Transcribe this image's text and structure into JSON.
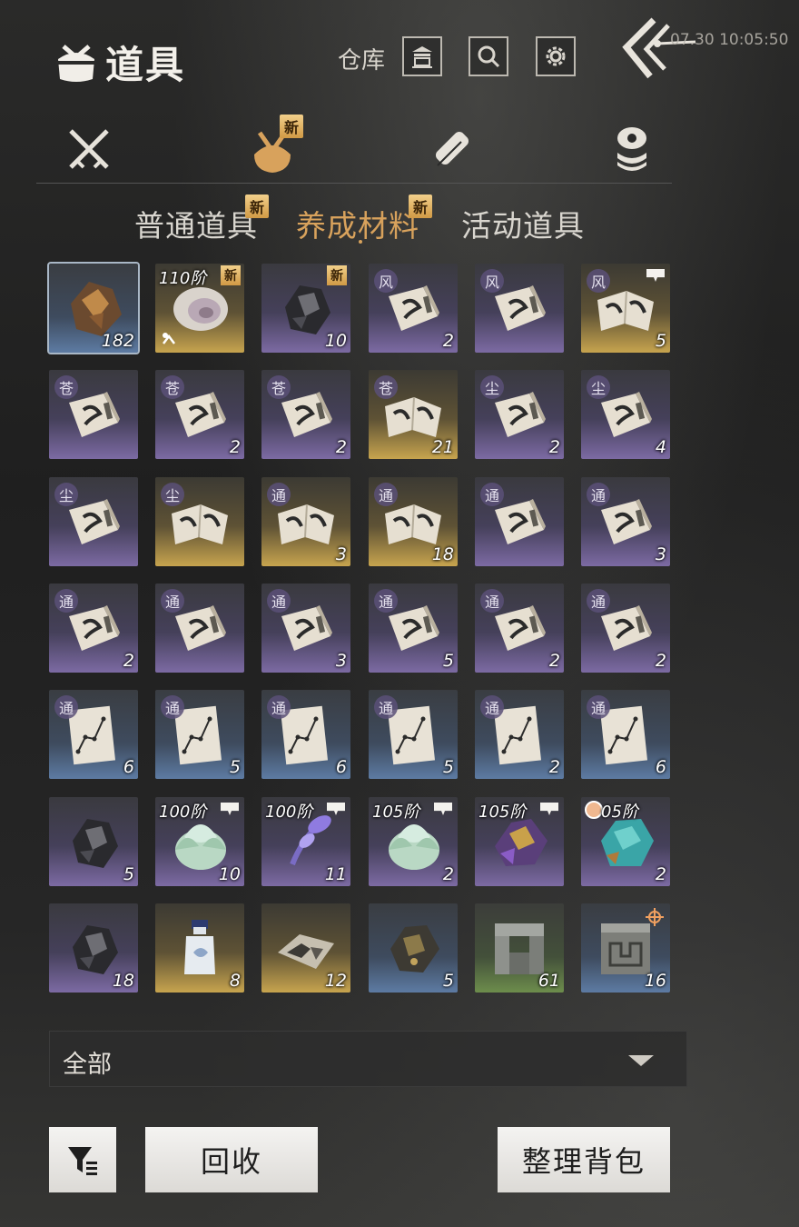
{
  "header": {
    "title": "道具",
    "warehouse_label": "仓库",
    "clock": "07.30 10:05:50"
  },
  "categories": [
    {
      "name": "weapons",
      "icon": "crossed-swords-icon",
      "new": false
    },
    {
      "name": "items",
      "icon": "bundle-sack-icon",
      "new": true,
      "active": true
    },
    {
      "name": "scrolls",
      "icon": "scroll-icon",
      "new": false
    },
    {
      "name": "materials",
      "icon": "gem-stack-icon",
      "new": false
    }
  ],
  "new_badge": "新",
  "subtabs": [
    {
      "label": "普通道具",
      "new": true,
      "active": false
    },
    {
      "label": "养成材料",
      "new": true,
      "active": true
    },
    {
      "label": "活动道具",
      "new": false,
      "active": false
    }
  ],
  "items": [
    {
      "art": "ore-brown",
      "bg": "blue",
      "count": "182",
      "selected": true
    },
    {
      "art": "shell",
      "bg": "gold",
      "tier": "110阶",
      "new": true,
      "up": true
    },
    {
      "art": "ore-dark",
      "bg": "purple",
      "count": "10",
      "new": true
    },
    {
      "art": "book",
      "bg": "purple",
      "glyph": "风",
      "count": "2"
    },
    {
      "art": "book",
      "bg": "purple",
      "glyph": "风",
      "count": ""
    },
    {
      "art": "book-open",
      "bg": "gold",
      "glyph": "风",
      "count": "5",
      "flag": true
    },
    {
      "art": "book",
      "bg": "purple",
      "glyph": "苍",
      "count": ""
    },
    {
      "art": "book",
      "bg": "purple",
      "glyph": "苍",
      "count": "2"
    },
    {
      "art": "book",
      "bg": "purple",
      "glyph": "苍",
      "count": "2"
    },
    {
      "art": "book-open",
      "bg": "gold",
      "glyph": "苍",
      "count": "21"
    },
    {
      "art": "book",
      "bg": "purple",
      "glyph": "尘",
      "count": "2"
    },
    {
      "art": "book",
      "bg": "purple",
      "glyph": "尘",
      "count": "4"
    },
    {
      "art": "book",
      "bg": "purple",
      "glyph": "尘",
      "count": ""
    },
    {
      "art": "book-open",
      "bg": "gold",
      "glyph": "尘",
      "count": ""
    },
    {
      "art": "book-open",
      "bg": "gold",
      "glyph": "通",
      "count": "3"
    },
    {
      "art": "book-open",
      "bg": "gold",
      "glyph": "通",
      "count": "18"
    },
    {
      "art": "book",
      "bg": "purple",
      "glyph": "通",
      "count": ""
    },
    {
      "art": "book",
      "bg": "purple",
      "glyph": "通",
      "count": "3"
    },
    {
      "art": "book",
      "bg": "purple",
      "glyph": "通",
      "count": "2"
    },
    {
      "art": "book",
      "bg": "purple",
      "glyph": "通",
      "count": ""
    },
    {
      "art": "book",
      "bg": "purple",
      "glyph": "通",
      "count": "3"
    },
    {
      "art": "book",
      "bg": "purple",
      "glyph": "通",
      "count": "5"
    },
    {
      "art": "book",
      "bg": "purple",
      "glyph": "通",
      "count": "2"
    },
    {
      "art": "book",
      "bg": "purple",
      "glyph": "通",
      "count": "2"
    },
    {
      "art": "chart",
      "bg": "blue",
      "glyph": "通",
      "count": "6"
    },
    {
      "art": "chart",
      "bg": "blue",
      "glyph": "通",
      "count": "5"
    },
    {
      "art": "chart",
      "bg": "blue",
      "glyph": "通",
      "count": "6"
    },
    {
      "art": "chart",
      "bg": "blue",
      "glyph": "通",
      "count": "5"
    },
    {
      "art": "chart",
      "bg": "blue",
      "glyph": "通",
      "count": "2"
    },
    {
      "art": "chart",
      "bg": "blue",
      "glyph": "通",
      "count": "6"
    },
    {
      "art": "ore-dark",
      "bg": "purple",
      "count": "5"
    },
    {
      "art": "jade-lotus",
      "bg": "purple",
      "tier": "100阶",
      "count": "10",
      "flag": true
    },
    {
      "art": "orchid",
      "bg": "purple",
      "tier": "100阶",
      "count": "11",
      "flag": true
    },
    {
      "art": "jade-lotus",
      "bg": "purple",
      "tier": "105阶",
      "count": "2",
      "flag": true
    },
    {
      "art": "amethyst",
      "bg": "purple",
      "tier": "105阶",
      "count": "",
      "flag": true
    },
    {
      "art": "turquoise",
      "bg": "purple",
      "tier": "05阶",
      "count": "2",
      "timer": true
    },
    {
      "art": "ore-dark",
      "bg": "purple",
      "count": "18"
    },
    {
      "art": "bottle",
      "bg": "gold",
      "count": "8"
    },
    {
      "art": "map",
      "bg": "gold",
      "count": "12"
    },
    {
      "art": "ore-gold",
      "bg": "blue",
      "count": "5"
    },
    {
      "art": "stone-frame",
      "bg": "green",
      "count": "61"
    },
    {
      "art": "stone-carved",
      "bg": "blue",
      "count": "16",
      "target": true
    }
  ],
  "filter": {
    "selected": "全部"
  },
  "buttons": {
    "recycle": "回收",
    "sort": "整理背包"
  }
}
